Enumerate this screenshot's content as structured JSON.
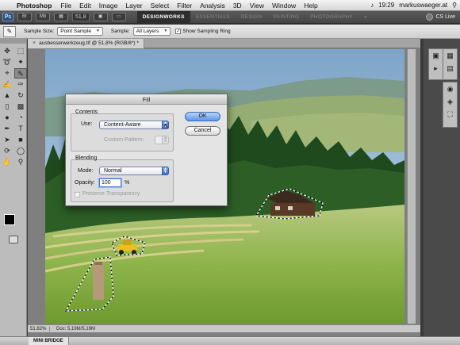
{
  "menubar": {
    "app": "Photoshop",
    "menus": [
      "File",
      "Edit",
      "Image",
      "Layer",
      "Select",
      "Filter",
      "Analysis",
      "3D",
      "View",
      "Window",
      "Help"
    ],
    "time": "19:29",
    "user": "markuswaeger.at"
  },
  "appbar": {
    "logo": "Ps",
    "zoom": "51,8",
    "workspaces": [
      "DESIGNWORKS",
      "ESSENTIALS",
      "DESIGN",
      "PAINTING",
      "PHOTOGRAPHY"
    ],
    "more": "»",
    "cslive": "CS Live"
  },
  "options": {
    "sample_size_label": "Sample Size:",
    "sample_size_value": "Point Sample",
    "sample_label": "Sample:",
    "sample_value": "All Layers",
    "show_ring_label": "Show Sampling Ring"
  },
  "document": {
    "tab_title": "ausbesserwerkzeug.tif @ 51,8% (RGB/8*) *",
    "status_zoom": "51.82%",
    "status_doc": "Doc: 5,19M/5,19M"
  },
  "dialog": {
    "title": "Fill",
    "contents_title": "Contents",
    "use_label": "Use:",
    "use_value": "Content-Aware",
    "custom_pattern_label": "Custom Pattern:",
    "blending_title": "Blending",
    "mode_label": "Mode:",
    "mode_value": "Normal",
    "opacity_label": "Opacity:",
    "opacity_value": "100",
    "opacity_unit": "%",
    "preserve_label": "Preserve Transparency",
    "ok_label": "OK",
    "cancel_label": "Cancel"
  },
  "minibridge": {
    "label": "MINI BRIDGE"
  },
  "icons": {
    "apple": "",
    "eyedropper": "✎",
    "cursor": "↖"
  },
  "colors": {
    "accent_blue": "#3d72c8",
    "ws_active": "#2e2e2e",
    "foreground": "#000000",
    "background": "#ffffff"
  }
}
